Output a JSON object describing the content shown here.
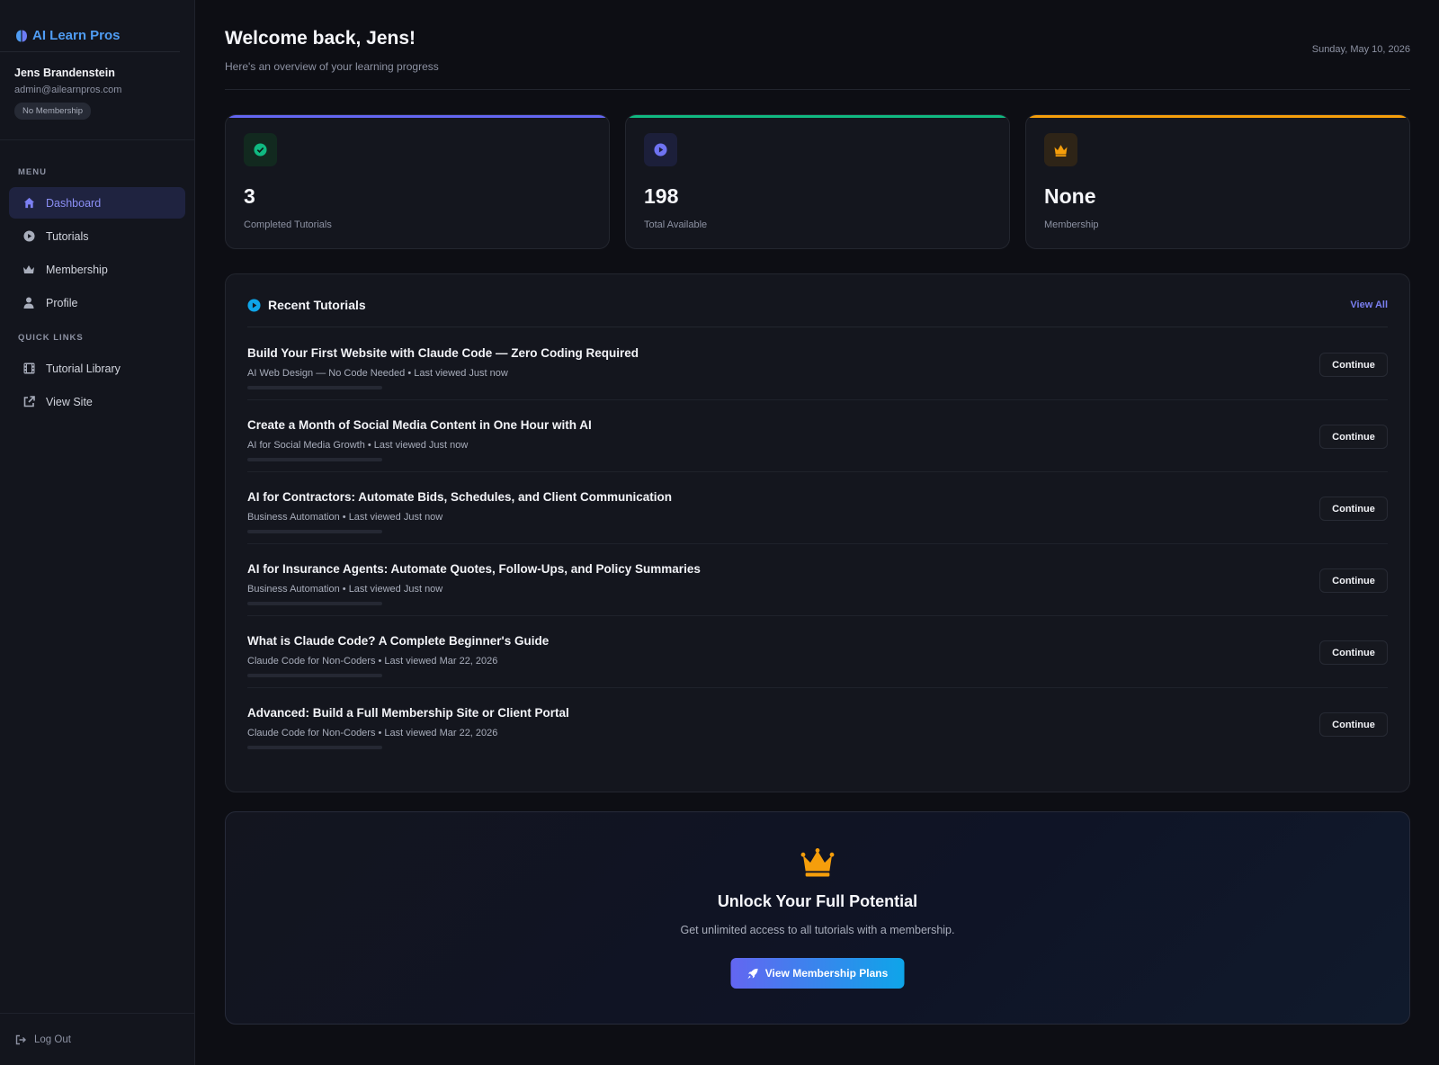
{
  "brand": {
    "name": "AI Learn Pros"
  },
  "user": {
    "name": "Jens Brandenstein",
    "email": "admin@ailearnpros.com",
    "membership_badge": "No Membership"
  },
  "sidebar": {
    "menu_label": "MENU",
    "menu_items": [
      {
        "label": "Dashboard",
        "icon": "home-icon",
        "active": true
      },
      {
        "label": "Tutorials",
        "icon": "play-circle-icon"
      },
      {
        "label": "Membership",
        "icon": "crown-icon"
      },
      {
        "label": "Profile",
        "icon": "user-icon"
      }
    ],
    "quick_links_label": "QUICK LINKS",
    "quick_links": [
      {
        "label": "Tutorial Library",
        "icon": "film-icon"
      },
      {
        "label": "View Site",
        "icon": "external-link-icon"
      }
    ],
    "logout_label": "Log Out"
  },
  "header": {
    "welcome": "Welcome back, Jens!",
    "subtitle": "Here's an overview of your learning progress",
    "date": "Sunday, May 10, 2026"
  },
  "stats": [
    {
      "value": "3",
      "label": "Completed Tutorials",
      "icon": "check-circle-icon",
      "color": "#10b981"
    },
    {
      "value": "198",
      "label": "Total Available",
      "icon": "play-circle-icon",
      "color": "#6366f1"
    },
    {
      "value": "None",
      "label": "Membership",
      "icon": "crown-icon",
      "color": "#f59e0b"
    }
  ],
  "recent": {
    "title": "Recent Tutorials",
    "view_all": "View All",
    "continue_label": "Continue",
    "items": [
      {
        "title": "Build Your First Website with Claude Code — Zero Coding Required",
        "meta": "AI Web Design — No Code Needed • Last viewed Just now",
        "progress": 0
      },
      {
        "title": "Create a Month of Social Media Content in One Hour with AI",
        "meta": "AI for Social Media Growth • Last viewed Just now",
        "progress": 0
      },
      {
        "title": "AI for Contractors: Automate Bids, Schedules, and Client Communication",
        "meta": "Business Automation • Last viewed Just now",
        "progress": 0
      },
      {
        "title": "AI for Insurance Agents: Automate Quotes, Follow-Ups, and Policy Summaries",
        "meta": "Business Automation • Last viewed Just now",
        "progress": 0
      },
      {
        "title": "What is Claude Code? A Complete Beginner's Guide",
        "meta": "Claude Code for Non-Coders • Last viewed Mar 22, 2026",
        "progress": 0
      },
      {
        "title": "Advanced: Build a Full Membership Site or Client Portal",
        "meta": "Claude Code for Non-Coders • Last viewed Mar 22, 2026",
        "progress": 0
      }
    ]
  },
  "promo": {
    "title": "Unlock Your Full Potential",
    "text": "Get unlimited access to all tutorials with a membership.",
    "button": "View Membership Plans"
  },
  "colors": {
    "accent": "#6366f1",
    "accent_secondary": "#0ea5e9",
    "brand": "#4f9cf3",
    "background": "#0d0e14"
  }
}
